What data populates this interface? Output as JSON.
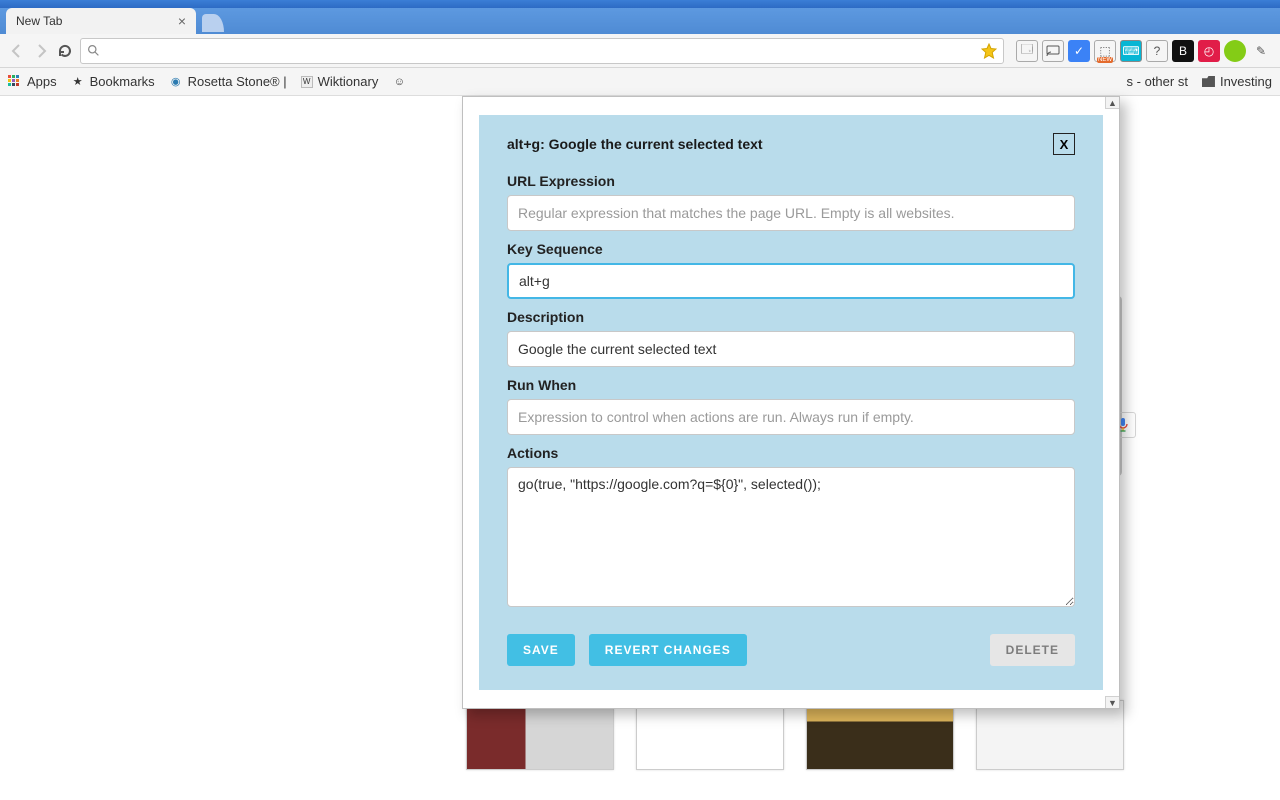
{
  "window": {
    "tab_title": "New Tab"
  },
  "toolbar": {
    "omnibox_value": ""
  },
  "bookmarks": {
    "apps": "Apps",
    "items": [
      {
        "label": "Bookmarks"
      },
      {
        "label": "Rosetta Stone® |"
      },
      {
        "label": "Wiktionary"
      }
    ],
    "right": [
      {
        "label": "s - other st"
      },
      {
        "label": "Investing"
      }
    ]
  },
  "popup": {
    "title": "alt+g: Google the current selected text",
    "close_label": "X",
    "labels": {
      "url_expression": "URL Expression",
      "key_sequence": "Key Sequence",
      "description": "Description",
      "run_when": "Run When",
      "actions": "Actions"
    },
    "placeholders": {
      "url_expression": "Regular expression that matches the page URL. Empty is all websites.",
      "run_when": "Expression to control when actions are run. Always run if empty."
    },
    "values": {
      "url_expression": "",
      "key_sequence": "alt+g",
      "description": "Google the current selected text",
      "run_when": "",
      "actions": "go(true, \"https://google.com?q=${0}\", selected());"
    },
    "buttons": {
      "save": "SAVE",
      "revert": "REVERT CHANGES",
      "delete": "DELETE"
    }
  }
}
